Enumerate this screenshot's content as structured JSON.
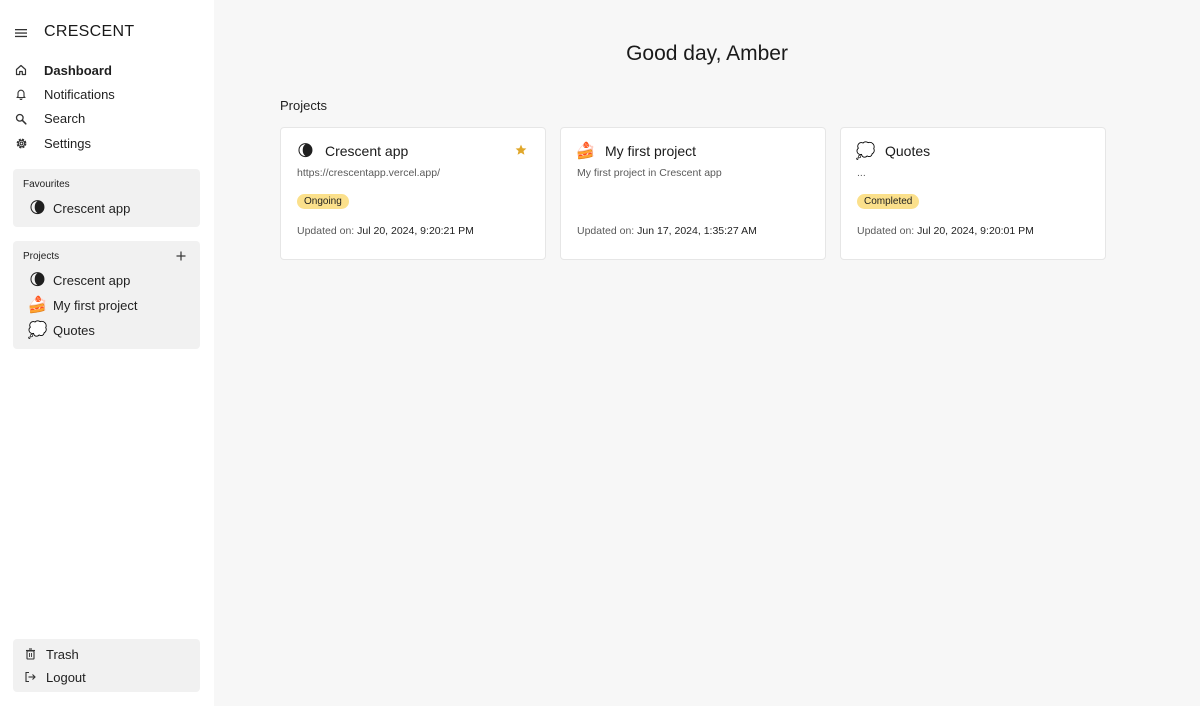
{
  "app": {
    "name": "CRESCENT"
  },
  "nav": {
    "items": [
      {
        "label": "Dashboard",
        "icon": "home-icon",
        "active": true
      },
      {
        "label": "Notifications",
        "icon": "bell-icon"
      },
      {
        "label": "Search",
        "icon": "search-icon"
      },
      {
        "label": "Settings",
        "icon": "gear-icon"
      }
    ]
  },
  "favourites": {
    "heading": "Favourites",
    "items": [
      {
        "label": "Crescent app",
        "emoji": "🌘"
      }
    ]
  },
  "projects": {
    "heading": "Projects",
    "items": [
      {
        "label": "Crescent app",
        "emoji": "🌘"
      },
      {
        "label": "My first project",
        "emoji": "🍰"
      },
      {
        "label": "Quotes",
        "emoji": "💭"
      }
    ]
  },
  "bottom": {
    "trash_label": "Trash",
    "logout_label": "Logout"
  },
  "main": {
    "greeting": "Good day, Amber",
    "section_title": "Projects",
    "updated_prefix": "Updated on:",
    "cards": [
      {
        "emoji": "🌘",
        "title": "Crescent app",
        "description": "https://crescentapp.vercel.app/",
        "status": "Ongoing",
        "updated": "Jul 20, 2024, 9:20:21 PM",
        "favourite": true
      },
      {
        "emoji": "🍰",
        "title": "My first project",
        "description": "My first project in Crescent app",
        "status": "",
        "updated": "Jun 17, 2024, 1:35:27 AM",
        "favourite": false
      },
      {
        "emoji": "💭",
        "title": "Quotes",
        "description": "...",
        "status": "Completed",
        "updated": "Jul 20, 2024, 9:20:01 PM",
        "favourite": false
      }
    ]
  },
  "colors": {
    "accent_star": "#e0a72a",
    "badge_bg": "#fbe08b",
    "sidebar_bg": "#ffffff",
    "panel_bg": "#f1f1f1",
    "main_bg": "#f7f7f7"
  }
}
